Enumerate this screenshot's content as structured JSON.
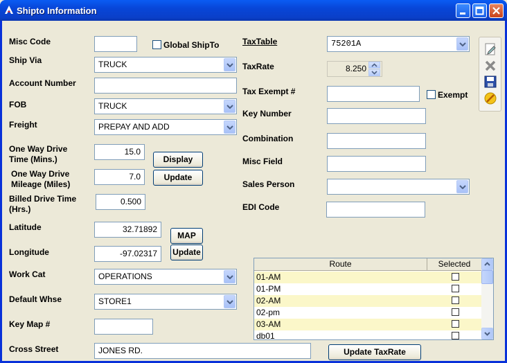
{
  "window": {
    "title": "Shipto Information"
  },
  "left": {
    "misc_code": {
      "label": "Misc Code",
      "value": ""
    },
    "global_shipto": {
      "label": "Global ShipTo",
      "checked": false
    },
    "ship_via": {
      "label": "Ship Via",
      "value": "TRUCK"
    },
    "account_number": {
      "label": "Account Number",
      "value": ""
    },
    "fob": {
      "label": "FOB",
      "value": "TRUCK"
    },
    "freight": {
      "label": "Freight",
      "value": "PREPAY AND ADD"
    },
    "drive_time": {
      "label_line1": "One Way Drive",
      "label_line2": "Time (Mins.)",
      "value": "15.0"
    },
    "drive_mileage": {
      "label_line1": "One Way Drive",
      "label_line2": "Mileage (Miles)",
      "value": "7.0"
    },
    "billed_time": {
      "label_line1": "Billed Drive Time",
      "label_line2": "(Hrs.)",
      "value": "0.500"
    },
    "display_button": "Display",
    "update_button": "Update",
    "latitude": {
      "label": "Latitude",
      "value": "32.71892"
    },
    "longitude": {
      "label": "Longitude",
      "value": "-97.02317"
    },
    "map_button": "MAP",
    "map_update_button": "Update",
    "work_cat": {
      "label": "Work Cat",
      "value": "OPERATIONS"
    },
    "default_whse": {
      "label": "Default Whse",
      "value": "STORE1"
    },
    "key_map": {
      "label": "Key Map #",
      "value": ""
    },
    "cross_street": {
      "label": "Cross Street",
      "value": "JONES RD."
    }
  },
  "right": {
    "tax_table": {
      "label": "TaxTable",
      "value": "75201A"
    },
    "tax_rate": {
      "label": "TaxRate",
      "value": "8.250"
    },
    "tax_exempt": {
      "label": "Tax Exempt #",
      "value": ""
    },
    "exempt": {
      "label": "Exempt",
      "checked": false
    },
    "key_number": {
      "label": "Key Number",
      "value": ""
    },
    "combination": {
      "label": "Combination",
      "value": ""
    },
    "misc_field": {
      "label": "Misc Field",
      "value": ""
    },
    "sales_person": {
      "label": "Sales Person",
      "value": ""
    },
    "edi_code": {
      "label": "EDI Code",
      "value": ""
    },
    "update_taxrate_button": "Update TaxRate"
  },
  "routes": {
    "columns": [
      "Route",
      "Selected"
    ],
    "rows": [
      {
        "route": "01-AM",
        "selected": false
      },
      {
        "route": "01-PM",
        "selected": false
      },
      {
        "route": "02-AM",
        "selected": false
      },
      {
        "route": "02-pm",
        "selected": false
      },
      {
        "route": "03-AM",
        "selected": false
      },
      {
        "route": "db01",
        "selected": false
      }
    ]
  },
  "toolbar": [
    "edit-icon",
    "delete-icon",
    "save-icon",
    "cancel-icon"
  ],
  "colors": {
    "title_bar": "#0a46d8",
    "row_highlight": "#fbf7c9",
    "window_bg": "#ece9d8"
  }
}
